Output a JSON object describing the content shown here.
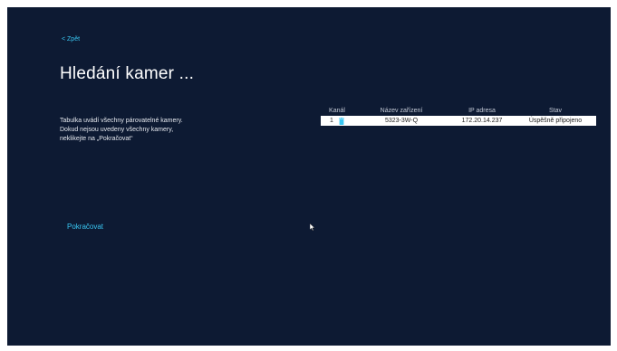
{
  "nav": {
    "back_label": "< Zpět"
  },
  "page": {
    "title": "Hledání kamer ...",
    "description_lines": [
      "Tabulka uvádí všechny párovatelné kamery.",
      "Dokud nejsou uvedeny všechny kamery,",
      "neklikejte na „Pokračovat“"
    ],
    "continue_label": "Pokračovat"
  },
  "table": {
    "columns": [
      "Kanál",
      "Název zařízení",
      "IP adresa",
      "Stav"
    ],
    "rows": [
      {
        "channel": "1",
        "delete_icon": "trash-icon",
        "device_name": "5323-3W-Q",
        "ip": "172.20.14.237",
        "status": "Úspěšně připojeno"
      }
    ]
  },
  "colors": {
    "background": "#0d1a33",
    "accent": "#39c6f2",
    "row_background": "#ffffff",
    "row_text": "#1a1a1a"
  }
}
